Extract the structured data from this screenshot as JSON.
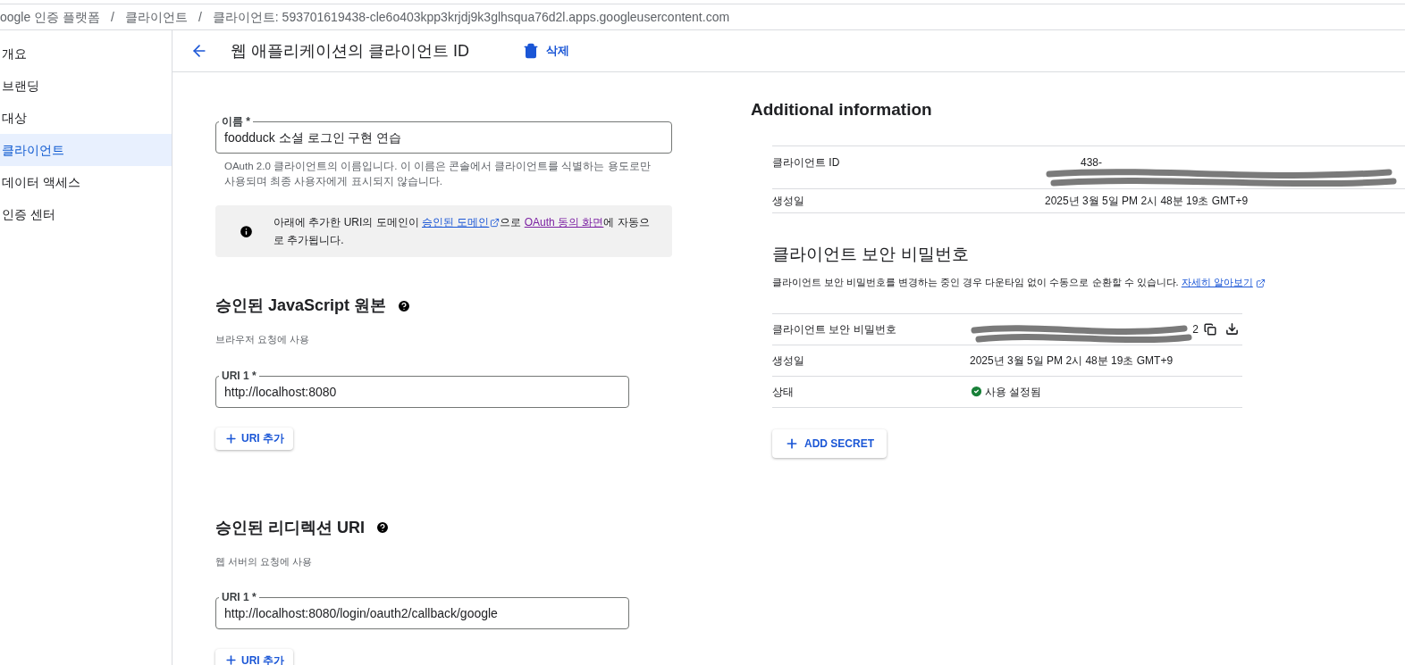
{
  "breadcrumbs": {
    "separator": "/",
    "items": [
      "oogle 인증 플랫폼",
      "클라이언트",
      "클라이언트: 593701619438-cle6o403kpp3krjdj9k3glhsqua76d2l.apps.googleusercontent.com"
    ]
  },
  "sidebar": {
    "items": [
      {
        "label": "개요",
        "selected": false
      },
      {
        "label": "브랜딩",
        "selected": false
      },
      {
        "label": "대상",
        "selected": false
      },
      {
        "label": "클라이언트",
        "selected": true
      },
      {
        "label": "데이터 액세스",
        "selected": false
      },
      {
        "label": "인증 센터",
        "selected": false
      }
    ]
  },
  "header": {
    "title": "웹 애플리케이션의 클라이언트 ID",
    "delete_label": "삭제"
  },
  "name_field": {
    "label": "이름 *",
    "value": "foodduck 소셜 로그인 구현 연습",
    "help": "OAuth 2.0 클라이언트의 이름입니다. 이 이름은 콘솔에서 클라이언트를 식별하는 용도로만 사용되며 최종 사용자에게 표시되지 않습니다."
  },
  "notice": {
    "before": "아래에 추가한 URI의 도메인이 ",
    "link1": "승인된 도메인",
    "middle": "으로 ",
    "link2": "OAuth 동의 화면",
    "after": "에 자동으로 추가됩니다."
  },
  "sections": [
    {
      "title": "승인된 JavaScript 원본",
      "subtitle": "브라우저 요청에 사용",
      "uris": [
        {
          "label": "URI 1 *",
          "value": "http://localhost:8080"
        }
      ],
      "add_label": "URI 추가"
    },
    {
      "title": "승인된 리디렉션 URI",
      "subtitle": "웹 서버의 요청에 사용",
      "uris": [
        {
          "label": "URI 1 *",
          "value": "http://localhost:8080/login/oauth2/callback/google"
        }
      ],
      "add_label": "URI 추가"
    }
  ],
  "additional": {
    "title": "Additional information",
    "rows": [
      {
        "kind": "redacted",
        "label": "클라이언트 ID",
        "value": "438-"
      },
      {
        "kind": "text",
        "label": "생성일",
        "value": "2025년 3월 5일 PM 2시 48분 19초 GMT+9"
      }
    ]
  },
  "secret": {
    "title": "클라이언트 보안 비밀번호",
    "description": "클라이언트 보안 비밀번호를 변경하는 중인 경우 다운타임 없이 수동으로 순환할 수 있습니다.",
    "link": "자세히 알아보기",
    "rows": [
      {
        "kind": "secret",
        "label": "클라이언트 보안 비밀번호",
        "value": "2"
      },
      {
        "kind": "text",
        "label": "생성일",
        "value": "2025년 3월 5일 PM 2시 48분 19초 GMT+9"
      },
      {
        "kind": "status",
        "label": "상태",
        "value": "사용 설정됨"
      }
    ],
    "add_label": "ADD SECRET"
  }
}
